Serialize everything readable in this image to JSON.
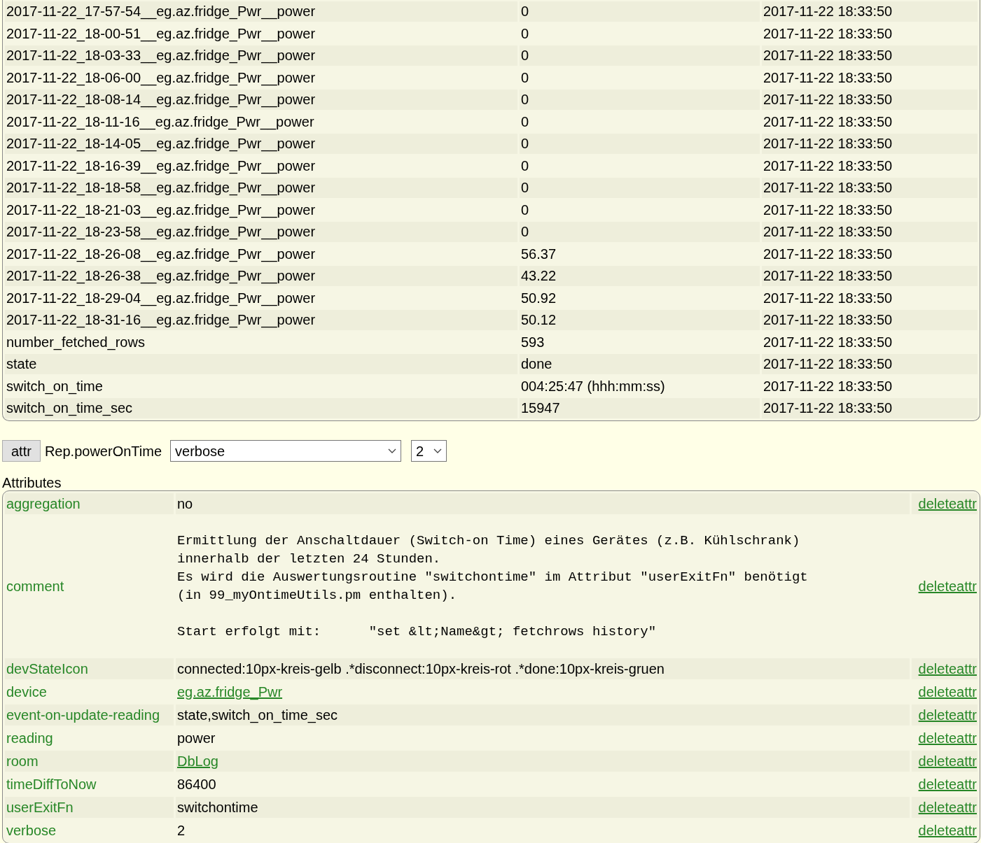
{
  "readings": [
    {
      "name": "2017-11-22_17-57-54__eg.az.fridge_Pwr__power",
      "value": "0",
      "time": "2017-11-22 18:33:50"
    },
    {
      "name": "2017-11-22_18-00-51__eg.az.fridge_Pwr__power",
      "value": "0",
      "time": "2017-11-22 18:33:50"
    },
    {
      "name": "2017-11-22_18-03-33__eg.az.fridge_Pwr__power",
      "value": "0",
      "time": "2017-11-22 18:33:50"
    },
    {
      "name": "2017-11-22_18-06-00__eg.az.fridge_Pwr__power",
      "value": "0",
      "time": "2017-11-22 18:33:50"
    },
    {
      "name": "2017-11-22_18-08-14__eg.az.fridge_Pwr__power",
      "value": "0",
      "time": "2017-11-22 18:33:50"
    },
    {
      "name": "2017-11-22_18-11-16__eg.az.fridge_Pwr__power",
      "value": "0",
      "time": "2017-11-22 18:33:50"
    },
    {
      "name": "2017-11-22_18-14-05__eg.az.fridge_Pwr__power",
      "value": "0",
      "time": "2017-11-22 18:33:50"
    },
    {
      "name": "2017-11-22_18-16-39__eg.az.fridge_Pwr__power",
      "value": "0",
      "time": "2017-11-22 18:33:50"
    },
    {
      "name": "2017-11-22_18-18-58__eg.az.fridge_Pwr__power",
      "value": "0",
      "time": "2017-11-22 18:33:50"
    },
    {
      "name": "2017-11-22_18-21-03__eg.az.fridge_Pwr__power",
      "value": "0",
      "time": "2017-11-22 18:33:50"
    },
    {
      "name": "2017-11-22_18-23-58__eg.az.fridge_Pwr__power",
      "value": "0",
      "time": "2017-11-22 18:33:50"
    },
    {
      "name": "2017-11-22_18-26-08__eg.az.fridge_Pwr__power",
      "value": "56.37",
      "time": "2017-11-22 18:33:50"
    },
    {
      "name": "2017-11-22_18-26-38__eg.az.fridge_Pwr__power",
      "value": "43.22",
      "time": "2017-11-22 18:33:50"
    },
    {
      "name": "2017-11-22_18-29-04__eg.az.fridge_Pwr__power",
      "value": "50.92",
      "time": "2017-11-22 18:33:50"
    },
    {
      "name": "2017-11-22_18-31-16__eg.az.fridge_Pwr__power",
      "value": "50.12",
      "time": "2017-11-22 18:33:50"
    },
    {
      "name": "number_fetched_rows",
      "value": "593",
      "time": "2017-11-22 18:33:50"
    },
    {
      "name": "state",
      "value": "done",
      "time": "2017-11-22 18:33:50"
    },
    {
      "name": "switch_on_time",
      "value": "004:25:47 (hhh:mm:ss)",
      "time": "2017-11-22 18:33:50"
    },
    {
      "name": "switch_on_time_sec",
      "value": "15947",
      "time": "2017-11-22 18:33:50"
    }
  ],
  "attr_form": {
    "button": "attr",
    "device": "Rep.powerOnTime",
    "attribute": "verbose",
    "value": "2"
  },
  "attributes_heading": "Attributes",
  "attributes": [
    {
      "name": "aggregation",
      "kind": "text",
      "value": "no",
      "action": "deleteattr"
    },
    {
      "name": "comment",
      "kind": "pre",
      "value": "Ermittlung der Anschaltdauer (Switch-on Time) eines Gerätes (z.B. Kühlschrank)\ninnerhalb der letzten 24 Stunden.\nEs wird die Auswertungsroutine \"switchontime\" im Attribut \"userExitFn\" benötigt\n(in 99_myOntimeUtils.pm enthalten).\n\nStart erfolgt mit:      \"set &lt;Name&gt; fetchrows history\"",
      "action": "deleteattr"
    },
    {
      "name": "devStateIcon",
      "kind": "text",
      "value": "connected:10px-kreis-gelb .*disconnect:10px-kreis-rot .*done:10px-kreis-gruen",
      "action": "deleteattr"
    },
    {
      "name": "device",
      "kind": "link",
      "value": "eg.az.fridge_Pwr",
      "action": "deleteattr"
    },
    {
      "name": "event-on-update-reading",
      "kind": "text",
      "value": "state,switch_on_time_sec",
      "action": "deleteattr"
    },
    {
      "name": "reading",
      "kind": "text",
      "value": "power",
      "action": "deleteattr"
    },
    {
      "name": "room",
      "kind": "link",
      "value": "DbLog",
      "action": "deleteattr"
    },
    {
      "name": "timeDiffToNow",
      "kind": "text",
      "value": "86400",
      "action": "deleteattr"
    },
    {
      "name": "userExitFn",
      "kind": "text",
      "value": "switchontime",
      "action": "deleteattr"
    },
    {
      "name": "verbose",
      "kind": "text",
      "value": "2",
      "action": "deleteattr"
    }
  ]
}
